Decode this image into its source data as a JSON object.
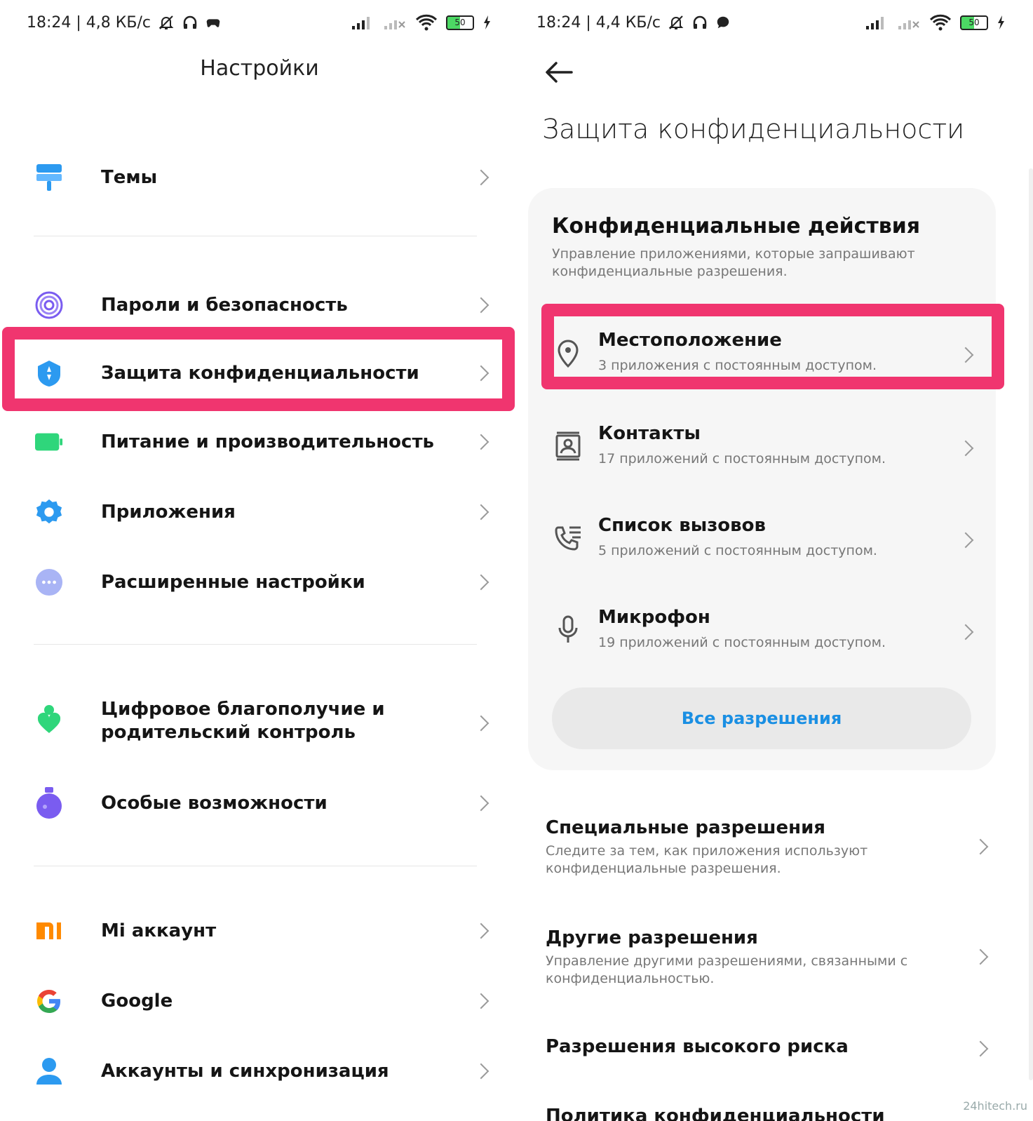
{
  "left": {
    "status": {
      "text": "18:24 | 4,8 КБ/с",
      "battery": "50"
    },
    "title": "Настройки",
    "items": [
      {
        "label": "Темы",
        "icon": "paint-roller-icon"
      },
      {
        "label": "Пароли и безопасность",
        "icon": "fingerprint-icon"
      },
      {
        "label": "Защита конфиденциальности",
        "icon": "privacy-shield-icon"
      },
      {
        "label": "Питание и производительность",
        "icon": "battery-icon"
      },
      {
        "label": "Приложения",
        "icon": "gear-icon"
      },
      {
        "label": "Расширенные настройки",
        "icon": "more-dots-icon"
      },
      {
        "label": "Цифровое благополучие и родительский контроль",
        "icon": "wellbeing-icon"
      },
      {
        "label": "Особые возможности",
        "icon": "accessibility-icon"
      },
      {
        "label": "Mi аккаунт",
        "icon": "mi-logo-icon"
      },
      {
        "label": "Google",
        "icon": "google-logo-icon"
      },
      {
        "label": "Аккаунты и синхронизация",
        "icon": "person-icon"
      }
    ]
  },
  "right": {
    "status": {
      "text": "18:24 | 4,4 КБ/с",
      "battery": "50"
    },
    "title": "Защита конфиденциальности",
    "card": {
      "title": "Конфиденциальные действия",
      "subtitle": "Управление приложениями, которые запрашивают конфиденциальные разрешения.",
      "permissions": [
        {
          "title": "Местоположение",
          "subtitle": "3 приложения с постоянным доступом.",
          "icon": "location-pin-icon"
        },
        {
          "title": "Контакты",
          "subtitle": "17 приложений с постоянным доступом.",
          "icon": "contacts-icon"
        },
        {
          "title": "Список вызовов",
          "subtitle": "5 приложений с постоянным доступом.",
          "icon": "call-log-icon"
        },
        {
          "title": "Микрофон",
          "subtitle": "19 приложений с постоянным доступом.",
          "icon": "microphone-icon"
        }
      ],
      "button": "Все разрешения"
    },
    "items": [
      {
        "title": "Специальные разрешения",
        "subtitle": "Следите за тем, как приложения используют конфиденциальные разрешения."
      },
      {
        "title": "Другие разрешения",
        "subtitle": "Управление другими разрешениями, связанными с конфиденциальностью."
      },
      {
        "title": "Разрешения высокого риска",
        "subtitle": ""
      },
      {
        "title": "Политика конфиденциальности",
        "subtitle": ""
      }
    ]
  },
  "watermark": "24hitech.ru",
  "colors": {
    "highlight": "#f0356f",
    "accent": "#1a8fe3"
  }
}
